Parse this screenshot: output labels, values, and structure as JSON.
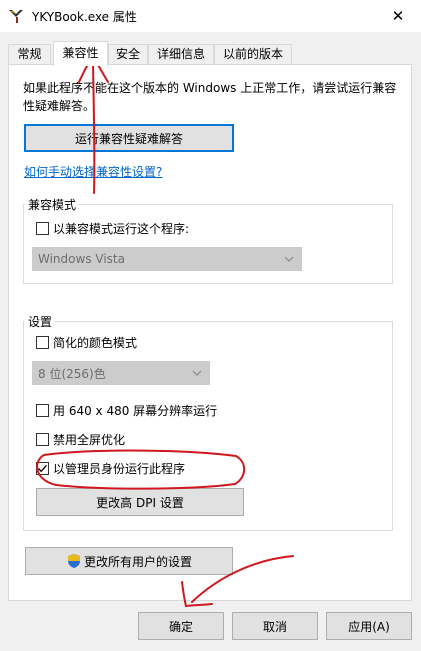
{
  "window": {
    "title": "YKYBook.exe 属性",
    "close_glyph": "✕"
  },
  "tabs": [
    {
      "label": "常规",
      "active": false
    },
    {
      "label": "兼容性",
      "active": true
    },
    {
      "label": "安全",
      "active": false
    },
    {
      "label": "详细信息",
      "active": false
    },
    {
      "label": "以前的版本",
      "active": false
    }
  ],
  "compat": {
    "description": "如果此程序不能在这个版本的 Windows 上正常工作，请尝试运行兼容性疑难解答。",
    "troubleshoot_button": "运行兼容性疑难解答",
    "manual_link": "如何手动选择兼容性设置?",
    "mode_group": {
      "title": "兼容模式",
      "checkbox_label": "以兼容模式运行这个程序:",
      "checked": false,
      "os_value": "Windows Vista"
    },
    "settings_group": {
      "title": "设置",
      "reduced_color": {
        "label": "简化的颜色模式",
        "checked": false
      },
      "color_value": "8 位(256)色",
      "res_640": {
        "label": "用 640 x 480 屏幕分辨率运行",
        "checked": false
      },
      "disable_fullscreen": {
        "label": "禁用全屏优化",
        "checked": false
      },
      "run_as_admin": {
        "label": "以管理员身份运行此程序",
        "checked": true
      },
      "dpi_button": "更改高 DPI 设置"
    },
    "all_users_button": "更改所有用户的设置"
  },
  "footer": {
    "ok": "确定",
    "cancel": "取消",
    "apply": "应用(A)"
  },
  "colors": {
    "focus_border": "#0078d7",
    "link": "#0066cc",
    "annotation_red": "#d0181e"
  }
}
